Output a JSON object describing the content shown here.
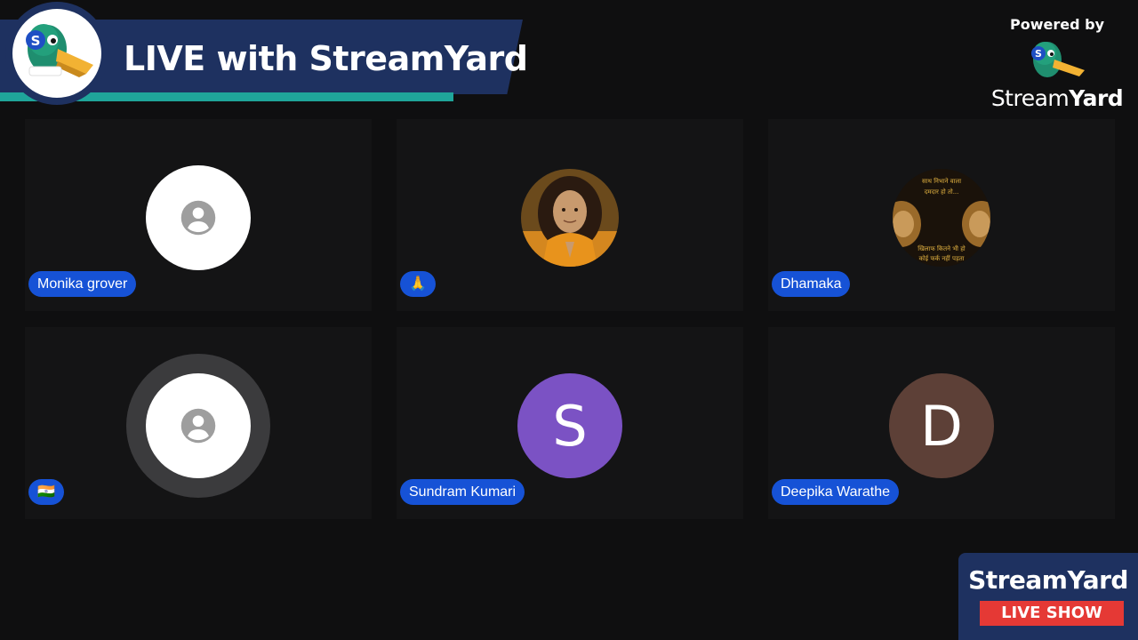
{
  "banner": {
    "title": "LIVE with StreamYard"
  },
  "powered": {
    "label": "Powered by",
    "brand_regular": "Stream",
    "brand_bold": "Yard"
  },
  "participants": [
    {
      "name": "Monika grover",
      "avatar": "default-person-icon"
    },
    {
      "name": "🙏",
      "avatar": "profile-photo-monk"
    },
    {
      "name": "Dhamaka",
      "avatar": "profile-photo-lions",
      "photo_text": [
        "साथ निभाने वाला",
        "दमदार हो तो...",
        "खिलाफ कितने भी हो",
        "कोई फर्क नहीं पड़ता"
      ]
    },
    {
      "name": "🇮🇳",
      "avatar": "default-person-icon"
    },
    {
      "name": "Sundram Kumari",
      "avatar": "letter",
      "letter": "S",
      "color": "#7b52c4"
    },
    {
      "name": "Deepika Warathe",
      "avatar": "letter",
      "letter": "D",
      "color": "#5d4037"
    }
  ],
  "badge": {
    "title": "StreamYard",
    "live_label": "LIVE SHOW"
  },
  "colors": {
    "banner": "#1e3160",
    "stripe": "#1fa59a",
    "name_tag": "#1652d6",
    "live": "#e53935"
  }
}
